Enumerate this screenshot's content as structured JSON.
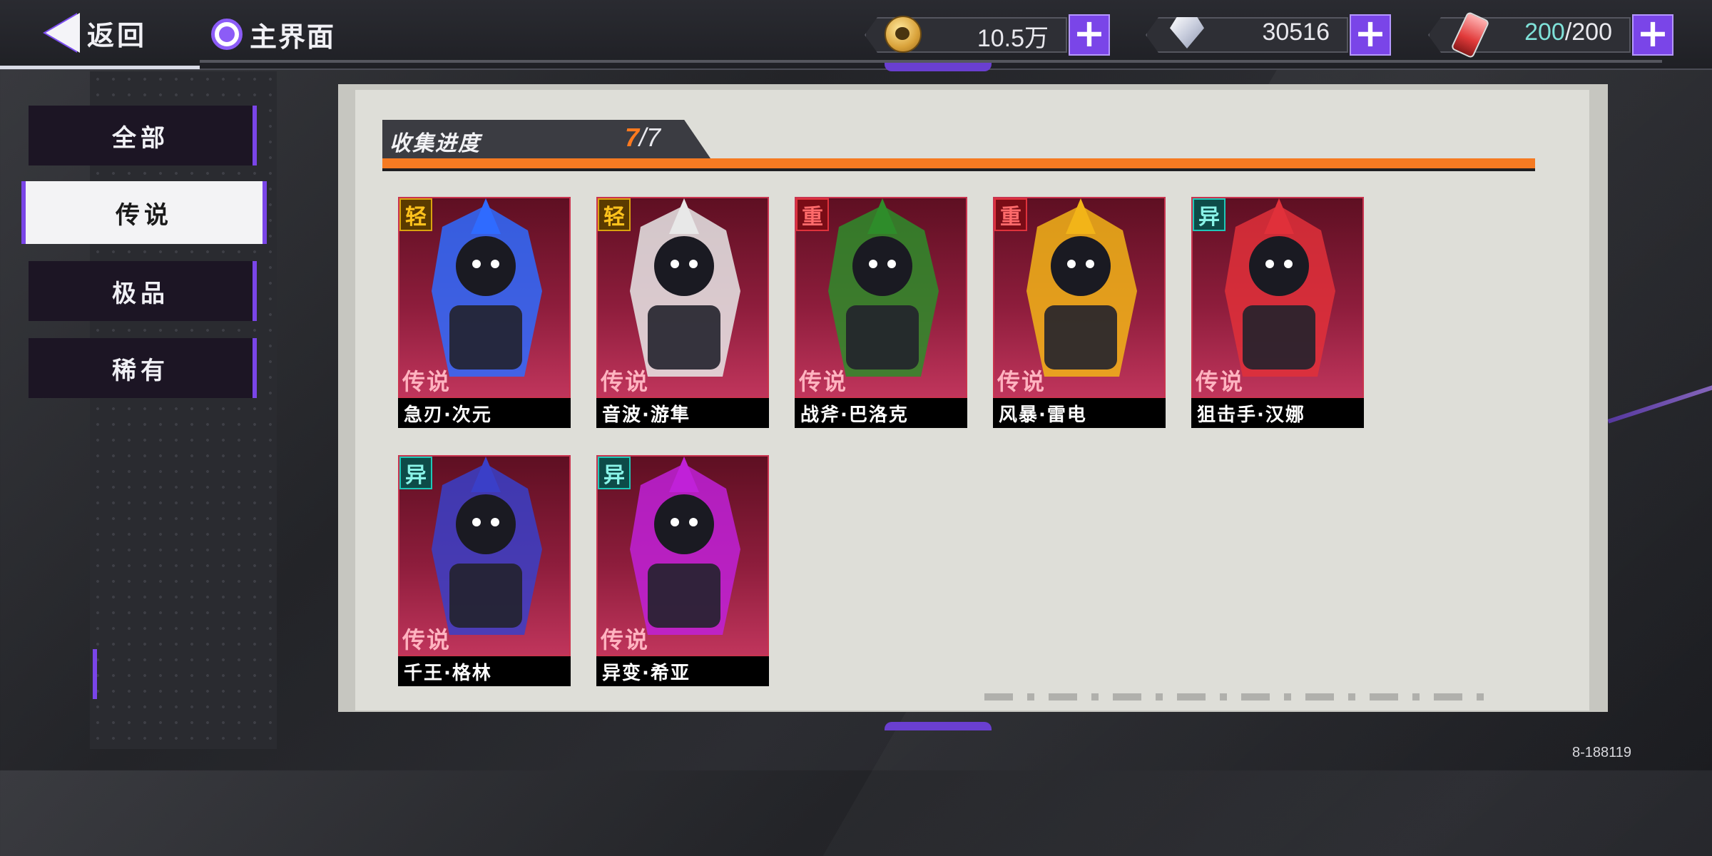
{
  "header": {
    "back_label": "返回",
    "home_label": "主界面",
    "resources": {
      "coins": "10.5万",
      "gems": "30516",
      "energy_current": "200",
      "energy_max": "200"
    }
  },
  "sidebar": {
    "items": [
      {
        "label": "全部",
        "active": false
      },
      {
        "label": "传说",
        "active": true
      },
      {
        "label": "极品",
        "active": false
      },
      {
        "label": "稀有",
        "active": false
      }
    ]
  },
  "collection": {
    "label": "收集进度",
    "current": "7",
    "total": "7",
    "progress": 1.0
  },
  "cards": [
    {
      "type": "轻",
      "rarity": "传说",
      "name": "急刃·次元",
      "accent": "#2f6bff"
    },
    {
      "type": "轻",
      "rarity": "传说",
      "name": "音波·游隼",
      "accent": "#e8e8e8"
    },
    {
      "type": "重",
      "rarity": "传说",
      "name": "战斧·巴洛克",
      "accent": "#2e8c2a"
    },
    {
      "type": "重",
      "rarity": "传说",
      "name": "风暴·雷电",
      "accent": "#f2b418"
    },
    {
      "type": "异",
      "rarity": "传说",
      "name": "狙击手·汉娜",
      "accent": "#e0303a"
    },
    {
      "type": "异",
      "rarity": "传说",
      "name": "千王·格林",
      "accent": "#3a3fc8"
    },
    {
      "type": "异",
      "rarity": "传说",
      "name": "异变·希亚",
      "accent": "#c021d8"
    }
  ],
  "footer": {
    "version": "8-188119"
  },
  "icons": {
    "coin": "coin-icon",
    "gem": "diamond-icon",
    "energy": "energy-vial-icon",
    "add": "plus-icon",
    "back": "back-arrow-icon",
    "home": "home-ring-icon"
  },
  "colors": {
    "accent_purple": "#7a45e8",
    "progress_orange": "#f57a22",
    "card_red": "#8e1d3c"
  }
}
